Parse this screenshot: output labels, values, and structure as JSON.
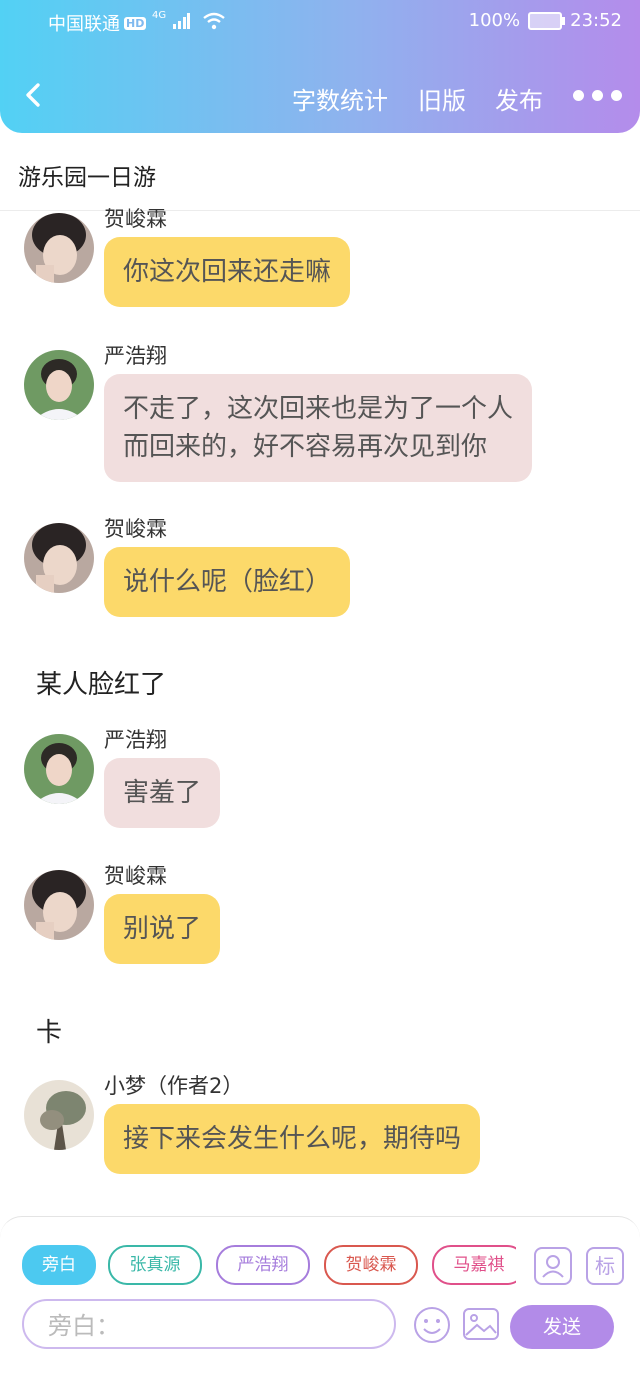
{
  "status": {
    "carrier": "中国联通",
    "hd": "HD",
    "network": "4G",
    "battery": "100%",
    "time": "23:52"
  },
  "nav": {
    "word_count": "字数统计",
    "old_version": "旧版",
    "publish": "发布"
  },
  "story_title": "游乐园一日游",
  "messages": [
    {
      "name": "贺峻霖",
      "text": "你这次回来还走嘛",
      "color": "#fcd96a"
    },
    {
      "name": "严浩翔",
      "line1": "不走了，这次回来也是为了一个人",
      "line2": "而回来的，好不容易再次见到你",
      "color": "#f1dede"
    },
    {
      "name": "贺峻霖",
      "text": "说什么呢（脸红）"
    },
    {
      "narration": "某人脸红了"
    },
    {
      "name": "严浩翔",
      "text": "害羞了"
    },
    {
      "name": "贺峻霖",
      "text": "别说了"
    },
    {
      "narration": "卡"
    },
    {
      "name": "小梦（作者2）",
      "text": "接下来会发生什么呢，期待吗"
    }
  ],
  "composer": {
    "chips": [
      {
        "label": "旁白",
        "color": "#4cc9f0",
        "selected": true
      },
      {
        "label": "张真源",
        "color": "#3ab8a8"
      },
      {
        "label": "严浩翔",
        "color": "#a67ddc"
      },
      {
        "label": "贺峻霖",
        "color": "#d9584f"
      },
      {
        "label": "马嘉祺",
        "color": "#e0508a"
      }
    ],
    "tag_label": "标",
    "input_placeholder": "旁白：",
    "send_label": "发送"
  }
}
